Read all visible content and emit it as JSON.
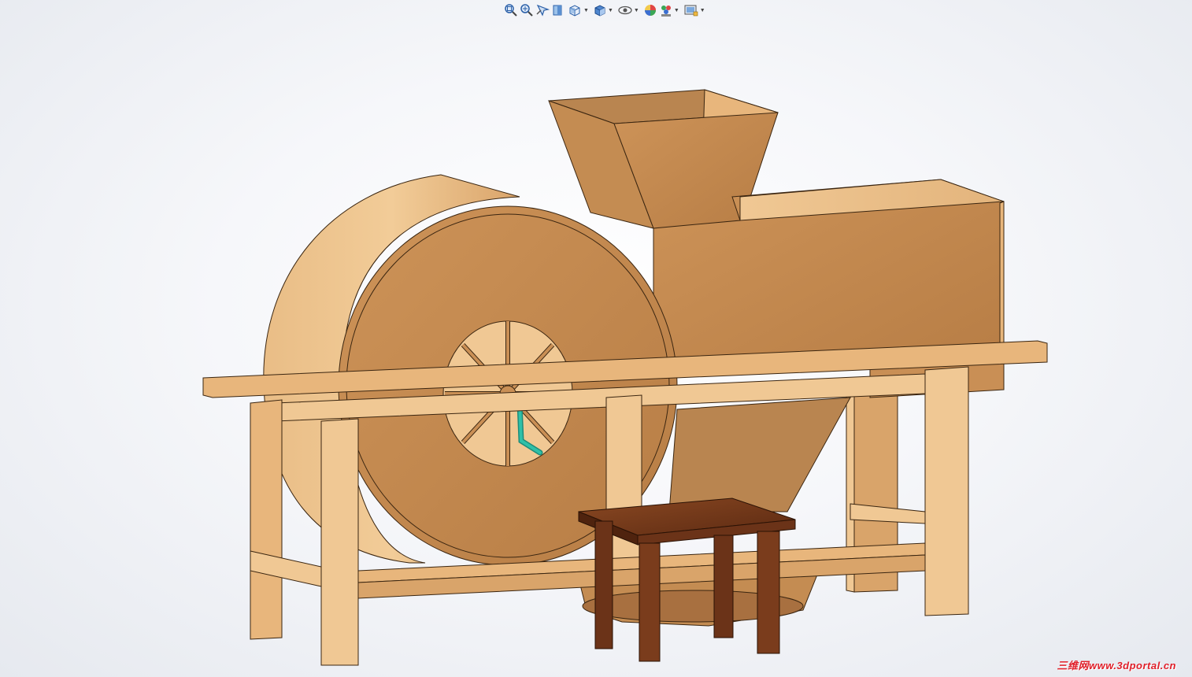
{
  "toolbar": {
    "items": [
      {
        "icon": "zoom-to-fit-icon"
      },
      {
        "icon": "zoom-to-area-icon"
      },
      {
        "icon": "previous-view-icon"
      },
      {
        "icon": "section-view-icon"
      },
      {
        "icon": "view-orientation-icon",
        "dropdown": true
      },
      {
        "icon": "display-style-icon",
        "dropdown": true
      },
      {
        "icon": "hide-show-items-icon",
        "dropdown": true
      },
      {
        "icon": "edit-appearance-icon"
      },
      {
        "icon": "apply-scene-icon",
        "dropdown": true
      },
      {
        "icon": "view-settings-icon",
        "dropdown": true
      }
    ]
  },
  "model": {
    "description": "wooden winnowing machine assembly with hand crank and stool"
  },
  "colors": {
    "wood_light": "#e8b67c",
    "wood_mid": "#c98f55",
    "wood_dark": "#a86e3c",
    "stool": "#6b3318",
    "crank": "#2fc0a8",
    "edge": "#3a2510"
  },
  "watermark": {
    "text": "三维网www.3dportal.cn"
  }
}
